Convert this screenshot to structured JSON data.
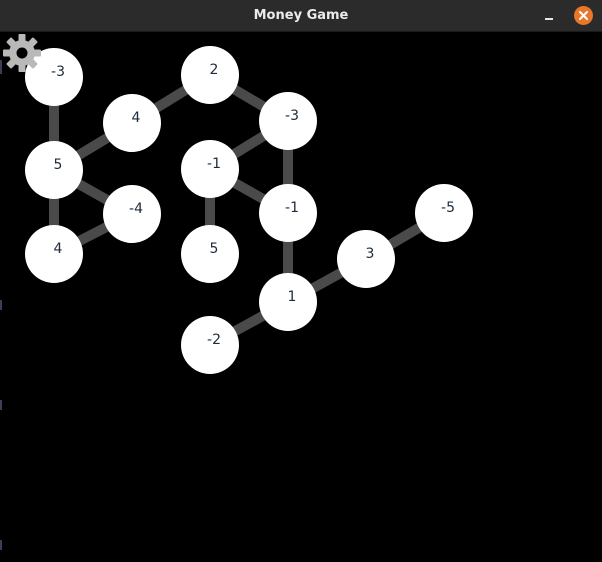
{
  "window": {
    "title": "Money Game"
  },
  "icons": {
    "settings": "gear-icon",
    "minimize": "minimize-icon",
    "close": "close-icon"
  },
  "colors": {
    "background": "#000000",
    "titlebar": "#2b2b2b",
    "node_fill": "#ffffff",
    "edge": "#4a4a4a",
    "close_button": "#e8762b",
    "node_text": "#1e2b3a"
  },
  "graph": {
    "nodes": [
      {
        "id": "n1",
        "value": "-3"
      },
      {
        "id": "n2",
        "value": "2"
      },
      {
        "id": "n3",
        "value": "4"
      },
      {
        "id": "n4",
        "value": "-3"
      },
      {
        "id": "n5",
        "value": "5"
      },
      {
        "id": "n6",
        "value": "-1"
      },
      {
        "id": "n7",
        "value": "-4"
      },
      {
        "id": "n8",
        "value": "-1"
      },
      {
        "id": "n9",
        "value": "-5"
      },
      {
        "id": "n10",
        "value": "4"
      },
      {
        "id": "n11",
        "value": "5"
      },
      {
        "id": "n12",
        "value": "3"
      },
      {
        "id": "n13",
        "value": "1"
      },
      {
        "id": "n14",
        "value": "-2"
      }
    ],
    "edges": [
      [
        "n1",
        "n5"
      ],
      [
        "n5",
        "n3"
      ],
      [
        "n3",
        "n2"
      ],
      [
        "n2",
        "n4"
      ],
      [
        "n5",
        "n7"
      ],
      [
        "n5",
        "n10"
      ],
      [
        "n7",
        "n10"
      ],
      [
        "n4",
        "n6"
      ],
      [
        "n4",
        "n8"
      ],
      [
        "n6",
        "n8"
      ],
      [
        "n6",
        "n11"
      ],
      [
        "n8",
        "n13"
      ],
      [
        "n13",
        "n12"
      ],
      [
        "n12",
        "n9"
      ],
      [
        "n13",
        "n14"
      ]
    ]
  }
}
